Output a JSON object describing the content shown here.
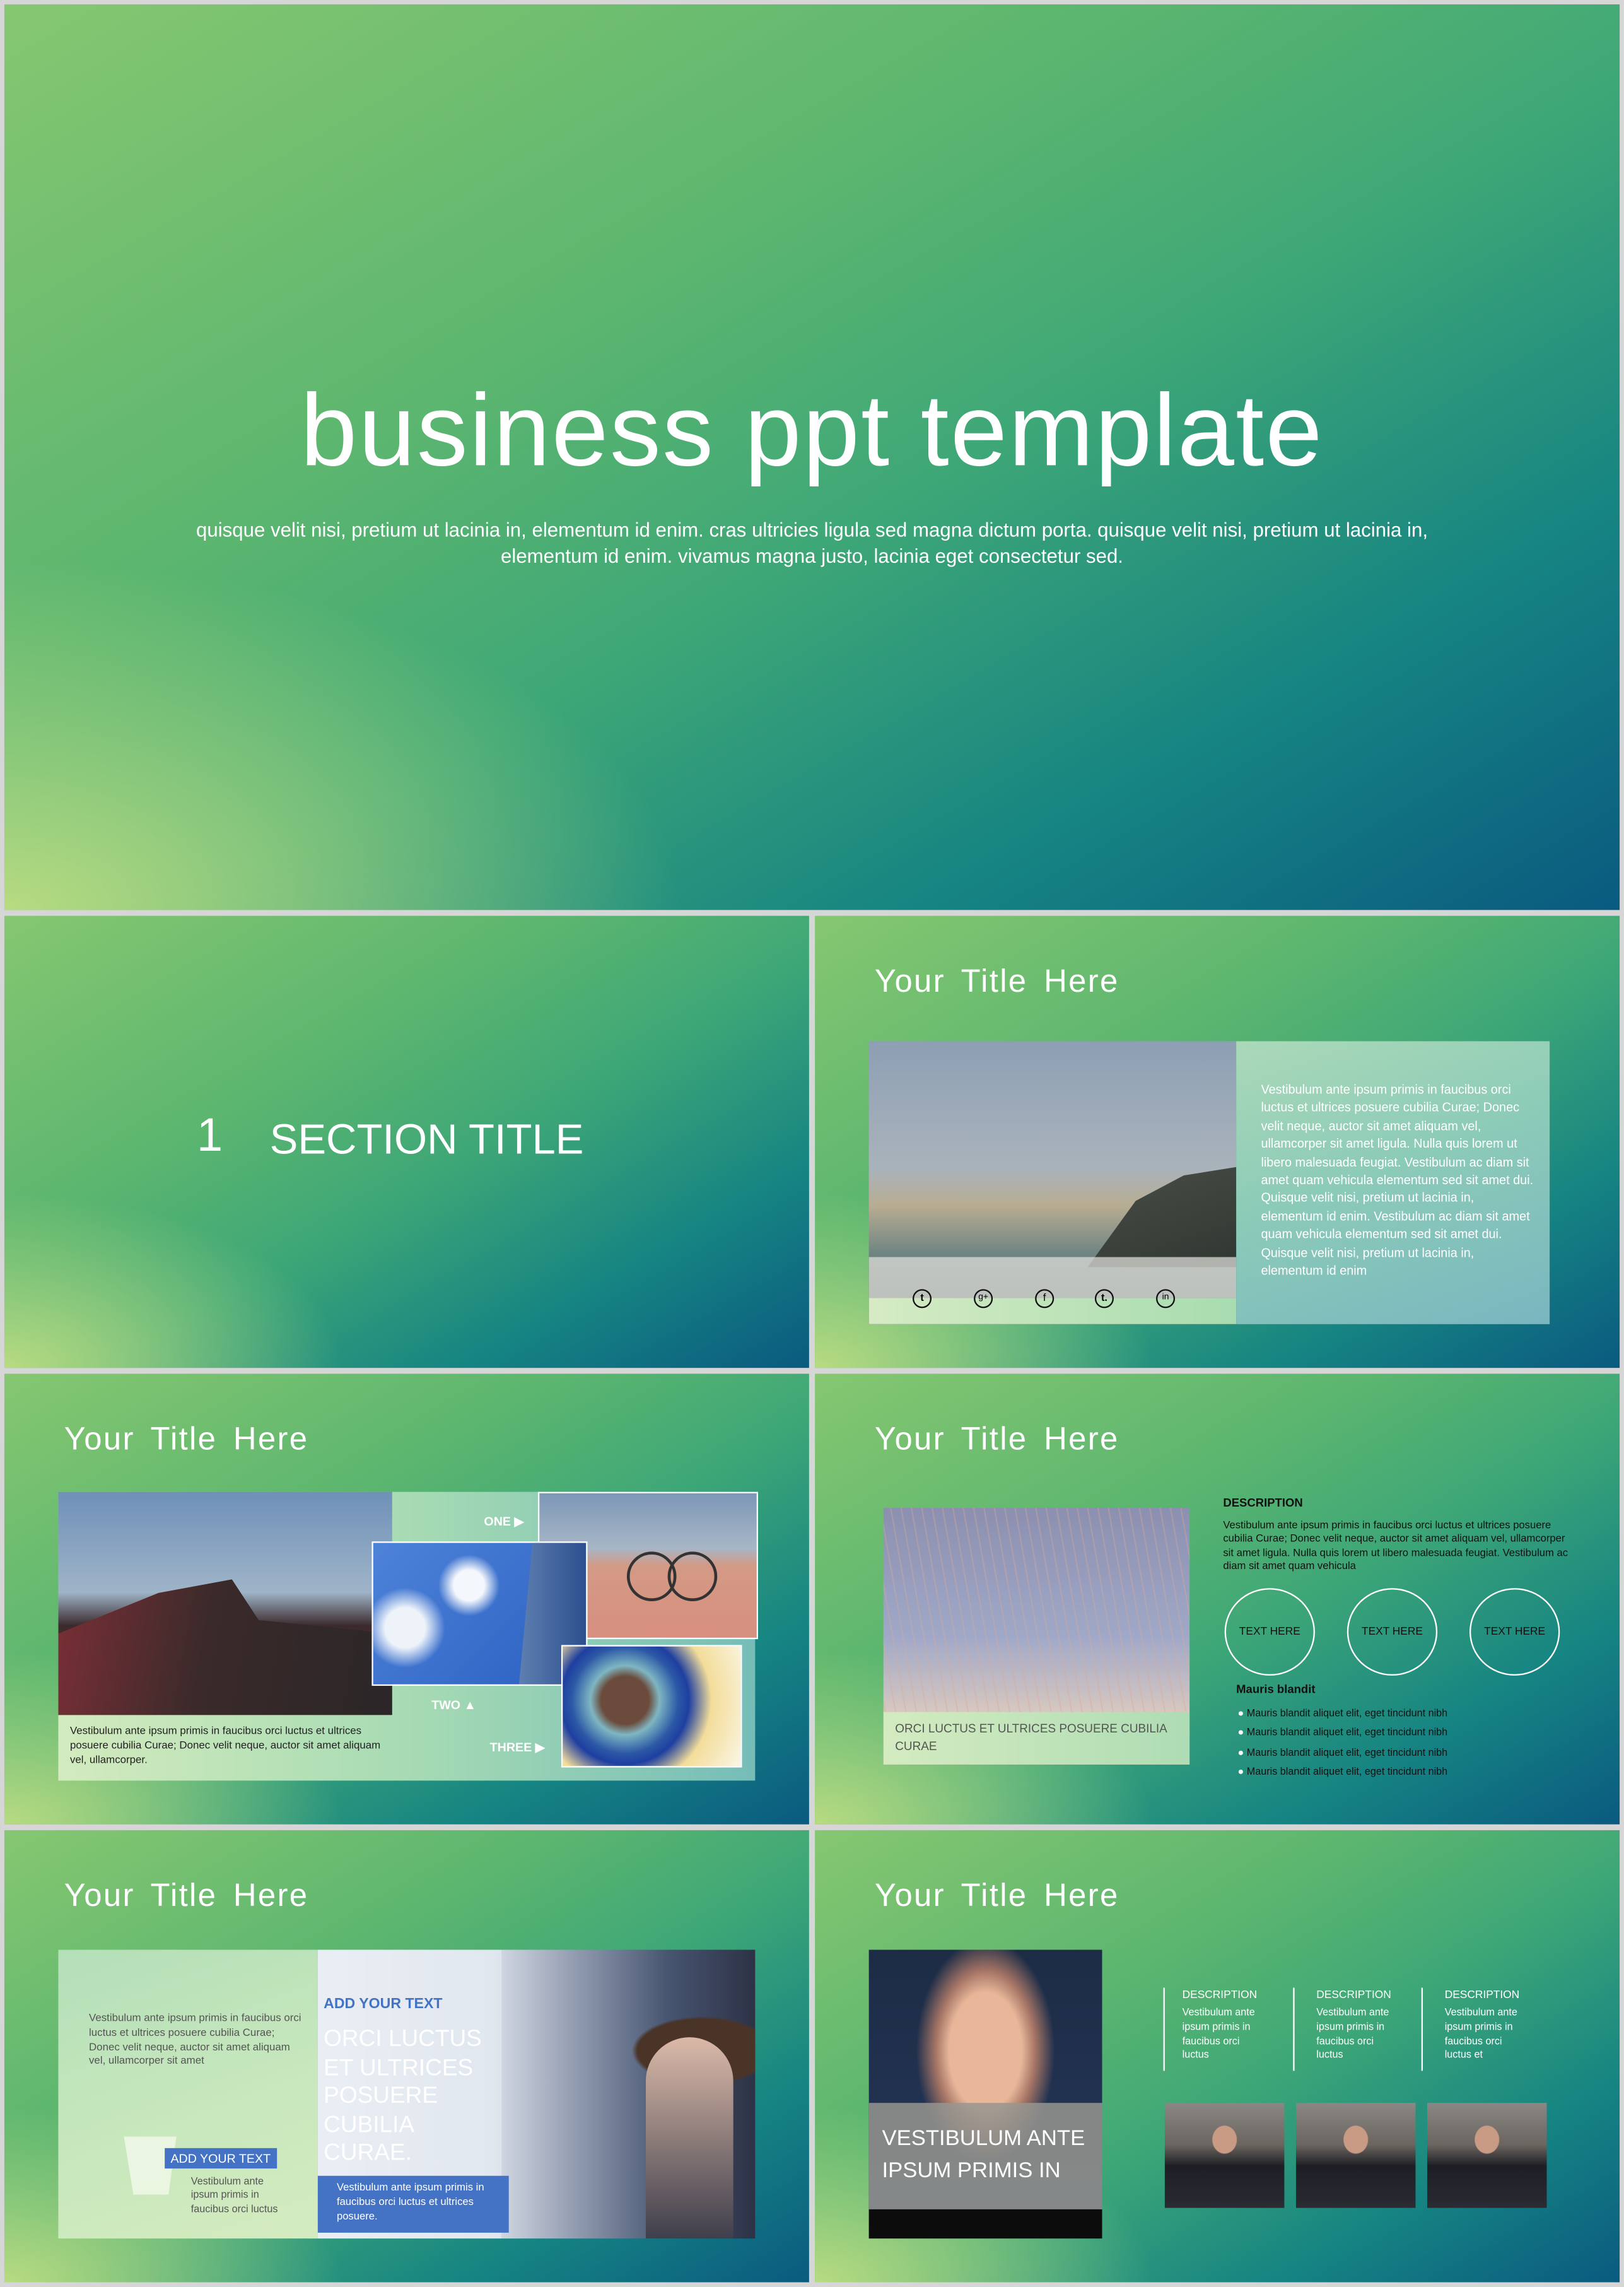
{
  "cover": {
    "title": "business ppt template",
    "subtitle_line1": "quisque velit nisi, pretium ut lacinia in, elementum id enim. cras ultricies ligula sed magna dictum porta. quisque velit nisi, pretium ut lacinia in,",
    "subtitle_line2": "elementum id enim. vivamus magna justo, lacinia eget consectetur sed."
  },
  "section": {
    "number": "1",
    "title": "SECTION TITLE"
  },
  "slide_social": {
    "title": "Your  Title  Here",
    "body": "Vestibulum ante ipsum primis in faucibus orci luctus et ultrices posuere cubilia Curae; Donec velit neque, auctor sit amet aliquam vel, ullamcorper sit amet ligula. Nulla quis lorem ut libero malesuada feugiat. Vestibulum ac diam sit amet quam vehicula elementum sed sit amet dui. Quisque velit nisi, pretium ut lacinia in, elementum id enim. Vestibulum ac diam sit amet quam vehicula elementum sed sit amet dui. Quisque velit nisi, pretium ut lacinia in, elementum id enim",
    "icons": [
      "twitter-icon",
      "google-plus-icon",
      "facebook-icon",
      "tumblr-icon",
      "linkedin-icon"
    ],
    "icon_glyphs": [
      "t",
      "g+",
      "f",
      "t.",
      "in"
    ]
  },
  "slide_gallery": {
    "title": "Your  Title  Here",
    "label_one": "ONE ▶",
    "label_two": "TWO ▲",
    "label_three": "THREE ▶",
    "body": "Vestibulum ante ipsum primis in faucibus orci luctus et ultrices posuere cubilia Curae; Donec velit neque, auctor sit amet aliquam vel, ullamcorper."
  },
  "slide_description": {
    "title": "Your  Title  Here",
    "caption": "ORCI LUCTUS ET ULTRICES POSUERE CUBILIA CURAE",
    "heading": "DESCRIPTION",
    "body": "Vestibulum ante ipsum primis in faucibus orci luctus et ultrices posuere cubilia Curae; Donec velit neque, auctor sit amet aliquam vel, ullamcorper sit amet ligula. Nulla quis lorem ut libero malesuada feugiat. Vestibulum ac diam sit amet quam vehicula",
    "circles": [
      "TEXT HERE",
      "TEXT HERE",
      "TEXT HERE"
    ],
    "list_title": "Mauris blandit",
    "bullets": [
      "Mauris blandit aliquet elit, eget tincidunt nibh",
      "Mauris blandit aliquet elit, eget tincidunt nibh",
      "Mauris blandit aliquet elit, eget tincidunt nibh",
      "Mauris blandit aliquet elit, eget tincidunt nibh"
    ]
  },
  "slide_travel": {
    "title": "Your  Title  Here",
    "left_body": "Vestibulum ante ipsum primis in faucibus orci luctus et ultrices posuere cubilia Curae; Donec velit neque, auctor sit amet aliquam vel, ullamcorper sit amet",
    "tag": "ADD YOUR TEXT",
    "tag_body": "Vestibulum ante ipsum primis in faucibus orci luctus",
    "heading": "ADD YOUR TEXT",
    "big_text": "ORCI LUCTUS ET ULTRICES POSUERE CUBILIA CURAE.",
    "callout": "Vestibulum ante ipsum primis in faucibus orci luctus et ultrices posuere.",
    "accent": "#4472c4"
  },
  "slide_team": {
    "title": "Your  Title  Here",
    "caption": "VESTIBULUM ANTE IPSUM PRIMIS IN",
    "columns": [
      {
        "heading": "DESCRIPTION",
        "body": "Vestibulum ante ipsum primis in faucibus orci luctus"
      },
      {
        "heading": "DESCRIPTION",
        "body": "Vestibulum ante ipsum primis in faucibus orci luctus"
      },
      {
        "heading": "DESCRIPTION",
        "body": "Vestibulum ante ipsum primis in faucibus orci luctus et"
      }
    ]
  }
}
